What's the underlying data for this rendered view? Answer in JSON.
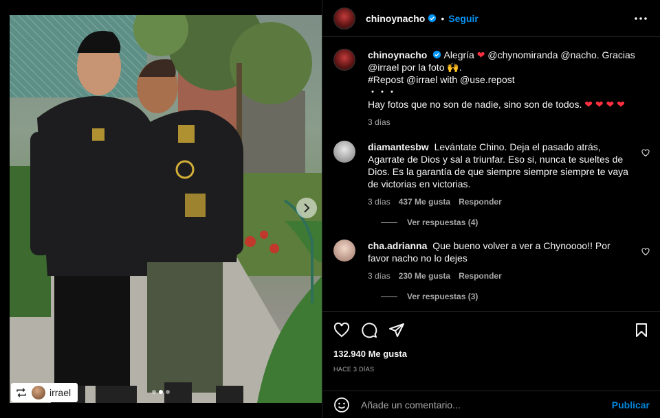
{
  "post": {
    "author": "chinoynacho",
    "follow_label": "Seguir",
    "separator": "•",
    "avatar_text": "CHINO NACHO"
  },
  "photo": {
    "repost_user": "irrael",
    "slide_count": 3,
    "active_slide": 1
  },
  "caption": {
    "username": "chinoynacho",
    "text_line1": "Alegría",
    "mentions": "@chynomiranda @nacho. Gracias @irrael por la foto 🙌.",
    "line2": "#Repost @irrael with @use.repost",
    "dots": "・・・",
    "line3": "Hay fotos que no son de nadie, sino son de todos.",
    "hearts": "❤ ❤ ❤ ❤",
    "time": "3 días"
  },
  "comments": [
    {
      "username": "diamantesbw",
      "text": "Levántate Chino. Deja el pasado atrás, Agarrate de Dios y sal a triunfar. Eso si, nunca te sueltes de Dios. Es la garantía de que siempre siempre siempre te vaya de victorias en victorias.",
      "time": "3 días",
      "likes": "437 Me gusta",
      "reply_label": "Responder",
      "view_replies": "Ver respuestas (4)"
    },
    {
      "username": "cha.adrianna",
      "text": "Que bueno volver a ver a Chynoooo!! Por favor nacho no lo dejes",
      "time": "3 días",
      "likes": "230 Me gusta",
      "reply_label": "Responder",
      "view_replies": "Ver respuestas (3)"
    }
  ],
  "stats": {
    "likes": "132.940 Me gusta",
    "date": "HACE 3 DÍAS"
  },
  "composer": {
    "placeholder": "Añade un comentario...",
    "publish_label": "Publicar"
  },
  "colors": {
    "accent": "#0095f6",
    "heart": "#ff3040",
    "background": "#000000",
    "muted_text": "#a8a8a8"
  }
}
